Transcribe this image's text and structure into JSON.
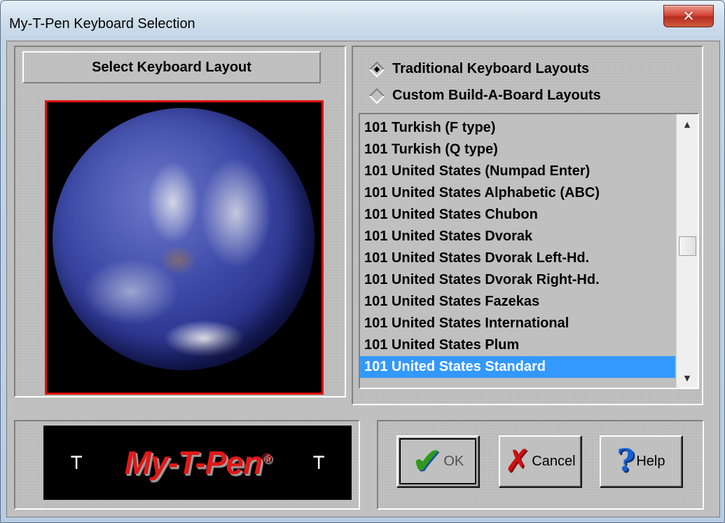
{
  "window": {
    "title": "My-T-Pen Keyboard Selection",
    "close_icon": "close-icon"
  },
  "left_panel": {
    "header": "Select Keyboard Layout",
    "image": "globe-earth"
  },
  "layout_type": {
    "options": [
      {
        "label": "Traditional Keyboard Layouts",
        "checked": true
      },
      {
        "label": "Custom Build-A-Board Layouts",
        "checked": false
      }
    ]
  },
  "layout_list": {
    "items": [
      "101 Turkish (F type)",
      "101 Turkish (Q type)",
      "101 United States (Numpad Enter)",
      "101 United States Alphabetic (ABC)",
      "101 United States Chubon",
      "101 United States Dvorak",
      "101 United States Dvorak Left-Hd.",
      "101 United States Dvorak Right-Hd.",
      "101 United States Fazekas",
      "101 United States International",
      "101 United States Plum",
      "101 United States Standard"
    ],
    "selected": "101 United States Standard",
    "selection_color": "#3399ff"
  },
  "logo": {
    "text": "My-T-Pen",
    "registered": "®",
    "color": "#e01818"
  },
  "buttons": {
    "ok": "OK",
    "cancel": "Cancel",
    "help": "Help"
  }
}
